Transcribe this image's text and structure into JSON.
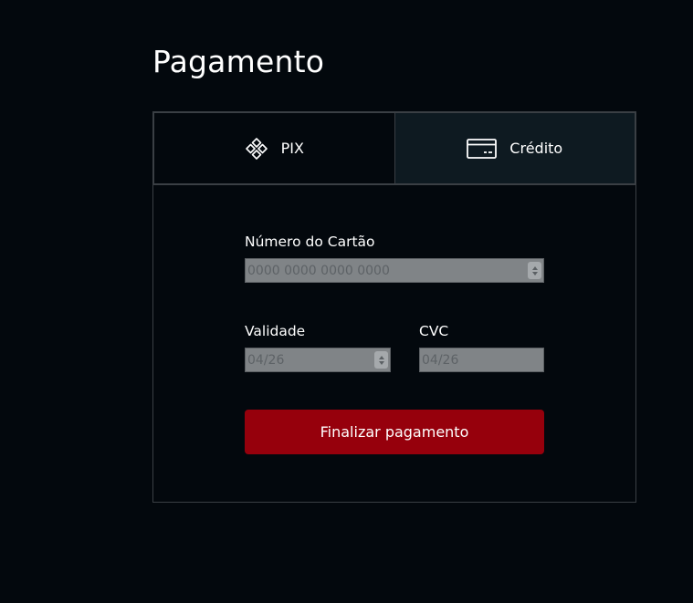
{
  "page": {
    "title": "Pagamento"
  },
  "tabs": [
    {
      "label": "PIX",
      "icon": "pix-icon",
      "active": false
    },
    {
      "label": "Crédito",
      "icon": "credit-card-icon",
      "active": true
    }
  ],
  "form": {
    "card_number": {
      "label": "Número do Cartão",
      "placeholder": "0000 0000 0000 0000",
      "value": ""
    },
    "expiry": {
      "label": "Validade",
      "placeholder": "04/26",
      "value": ""
    },
    "cvc": {
      "label": "CVC",
      "placeholder": "04/26",
      "value": ""
    },
    "submit_label": "Finalizar pagamento"
  },
  "colors": {
    "background": "#03080d",
    "active_tab": "#0e1a21",
    "button": "#96000c",
    "input": "#808487"
  }
}
